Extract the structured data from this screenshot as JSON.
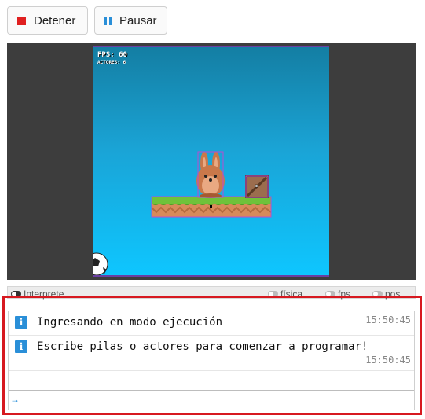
{
  "toolbar_buttons": {
    "stop_label": "Detener",
    "pause_label": "Pausar"
  },
  "stage": {
    "fps_text": "FPS: 60",
    "actors_text": "ACTORES: 6"
  },
  "console_tabs": {
    "interpreter": "Interprete",
    "physics": "física",
    "fps": "fps",
    "pos": "pos"
  },
  "console": {
    "messages": [
      {
        "text": "Ingresando en modo ejecución",
        "time": "15:50:45"
      },
      {
        "text": "Escribe pilas o actores para comenzar a programar!",
        "time": "15:50:45"
      }
    ],
    "input_value": ""
  },
  "colors": {
    "stop": "#e02020",
    "accent_blue": "#2a8fd8",
    "highlight_border": "#d71920",
    "stage_frame": "#3d3d3d"
  }
}
